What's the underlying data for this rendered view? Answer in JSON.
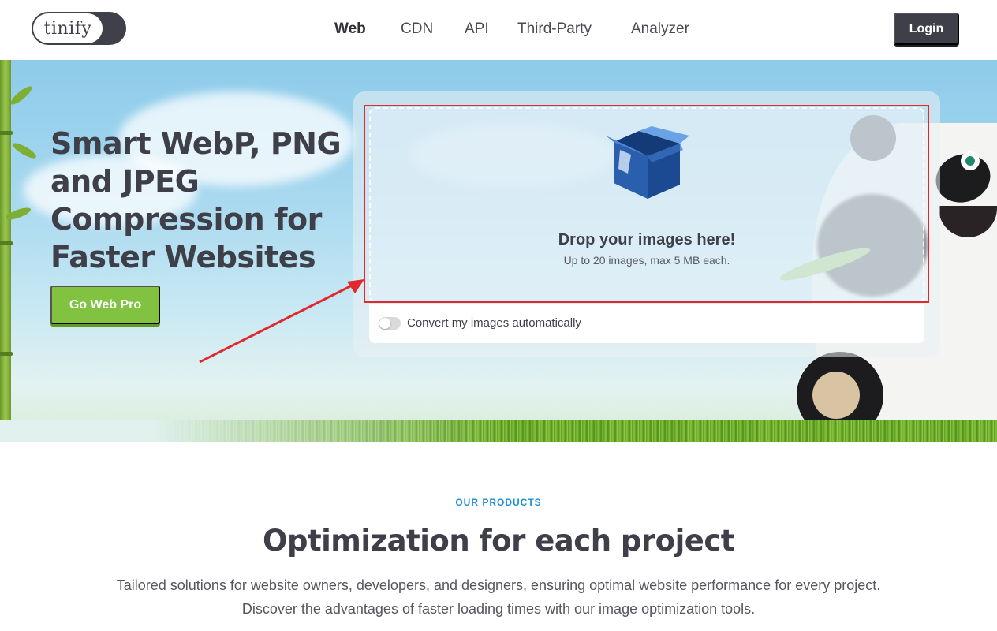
{
  "header": {
    "logo_text": "tinify",
    "nav": {
      "web": "Web",
      "cdn": "CDN",
      "api": "API",
      "third_party": "Third-Party",
      "analyzer": "Analyzer"
    },
    "login_label": "Login"
  },
  "hero": {
    "title": "Smart WebP, PNG and JPEG Compression for Faster Websites",
    "cta_label": "Go Web Pro",
    "upload": {
      "title": "Drop your images here!",
      "subtitle": "Up to 20 images, max 5 MB each.",
      "convert_label": "Convert my images automatically",
      "convert_enabled": false
    }
  },
  "products": {
    "eyebrow": "OUR PRODUCTS",
    "title": "Optimization for each project",
    "description": "Tailored solutions for website owners, developers, and designers, ensuring optimal website performance for every project. Discover the advantages of faster loading times with our image optimization tools."
  },
  "colors": {
    "accent_green": "#81c341",
    "dark": "#3e3f48",
    "eyebrow_blue": "#1b8fd8",
    "highlight_red": "#e0282e"
  },
  "icons": {
    "box": "open-box-icon",
    "toggle": "toggle-switch"
  }
}
